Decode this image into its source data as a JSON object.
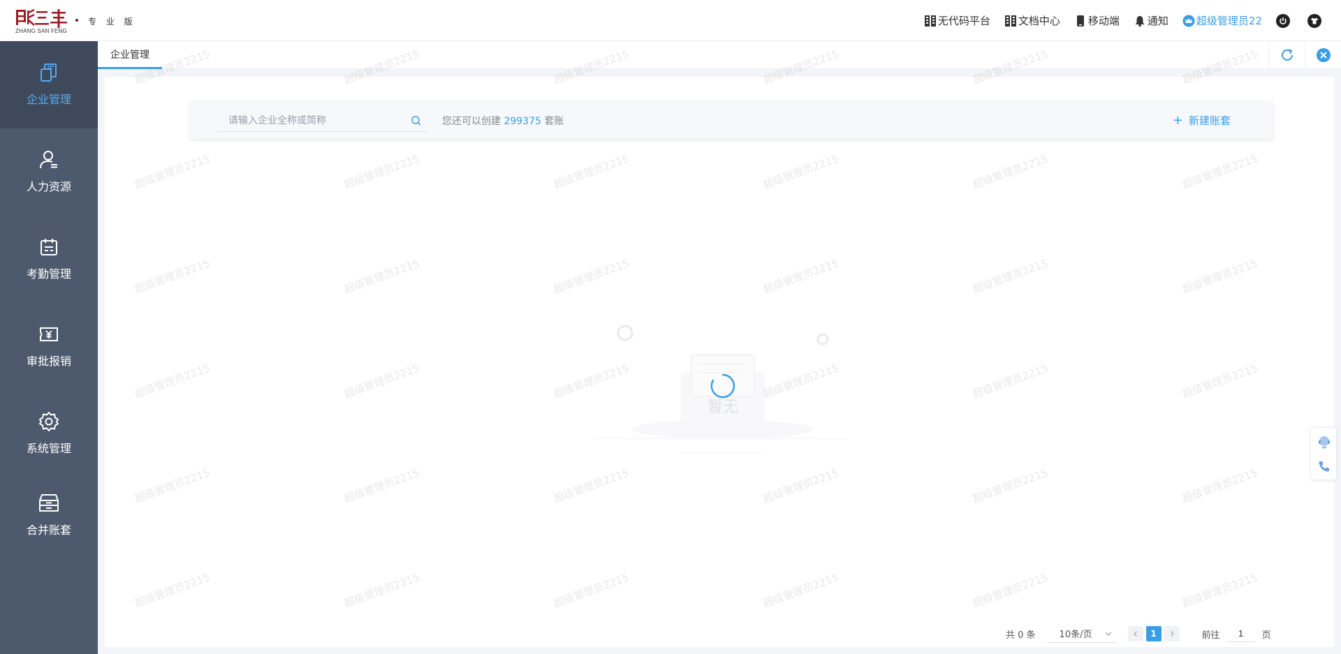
{
  "brand": {
    "logo_text": "ZHANG SAN FENG",
    "edition": "专 业 版",
    "brand_color": "#9b1c24"
  },
  "topnav": {
    "items": [
      {
        "label": "无代码平台",
        "icon": "building-icon"
      },
      {
        "label": "文档中心",
        "icon": "building-icon"
      },
      {
        "label": "移动端",
        "icon": "phone-icon"
      },
      {
        "label": "通知",
        "icon": "bell-icon"
      }
    ],
    "user": {
      "label": "超级管理员22",
      "icon": "crown-icon"
    },
    "power_icon": "power-icon",
    "theme_icon": "shirt-icon"
  },
  "sidebar": {
    "items": [
      {
        "label": "企业管理",
        "icon": "copy-icon",
        "active": true
      },
      {
        "label": "人力资源",
        "icon": "user-icon"
      },
      {
        "label": "考勤管理",
        "icon": "calendar-icon"
      },
      {
        "label": "审批报销",
        "icon": "ticket-icon"
      },
      {
        "label": "系统管理",
        "icon": "gear-icon"
      },
      {
        "label": "合并账套",
        "icon": "archive-icon"
      }
    ]
  },
  "tabs": [
    {
      "label": "企业管理",
      "active": true
    }
  ],
  "search": {
    "placeholder": "请输入企业全称或简称",
    "value": ""
  },
  "quota": {
    "prefix": "您还可以创建",
    "count": "299375",
    "suffix": "套账"
  },
  "actions": {
    "new_book": "新建账套"
  },
  "empty_state": {
    "text": "暂无"
  },
  "pagination": {
    "total": "共 0 条",
    "page_size": "10条/页",
    "current_page": "1",
    "goto_prefix": "前往",
    "goto_value": "1",
    "goto_suffix": "页"
  },
  "watermark": {
    "text": "超级管理员2215"
  },
  "colors": {
    "accent": "#3a9ee6",
    "sidebar_bg": "#4d5a6d",
    "sidebar_active_bg": "#3e4a5c"
  }
}
